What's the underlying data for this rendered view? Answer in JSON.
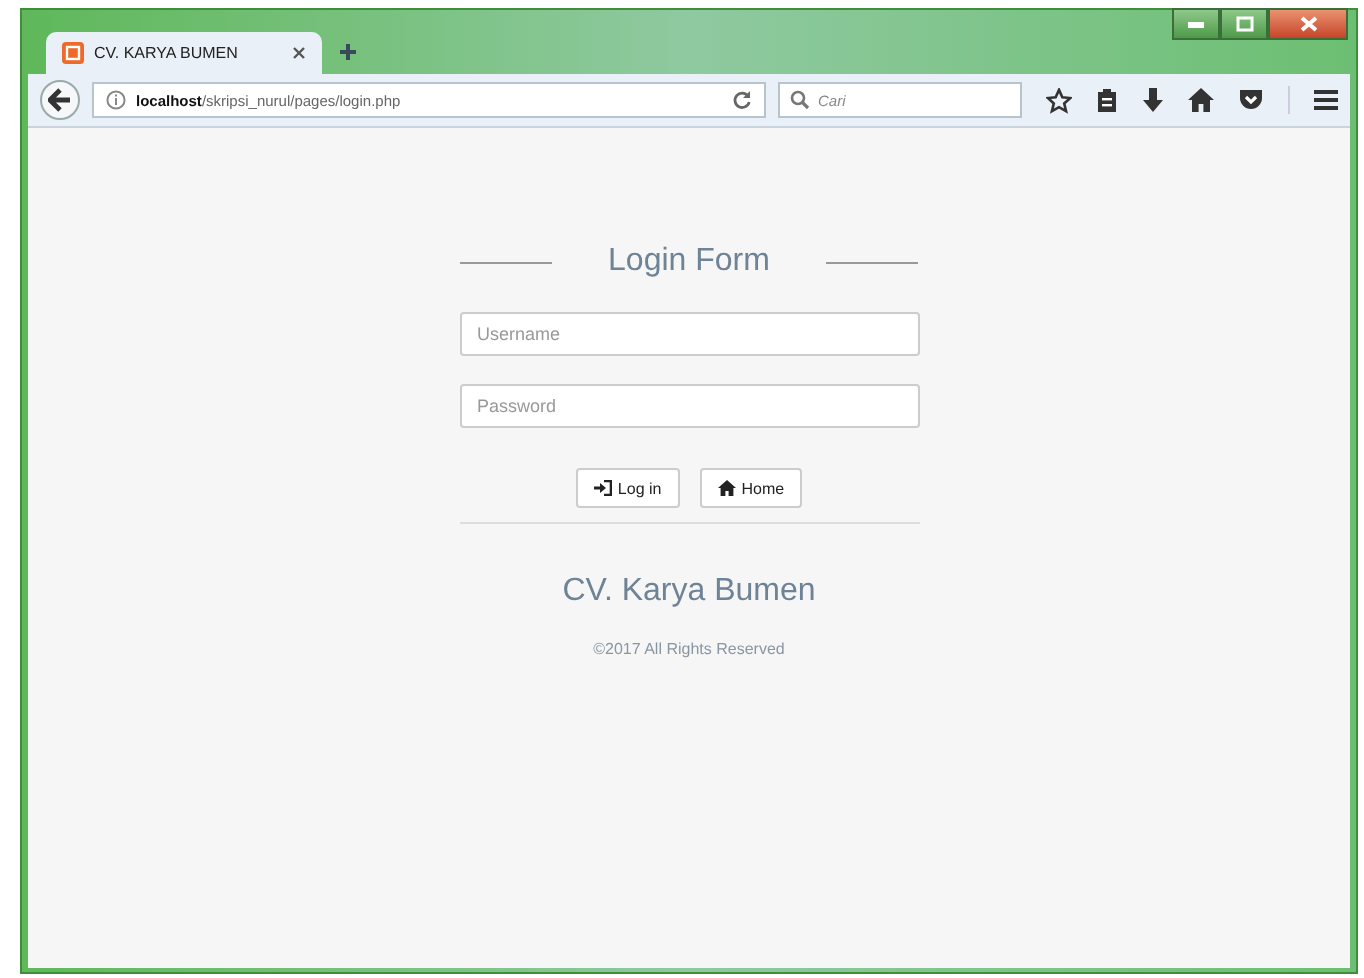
{
  "window": {
    "tabs": [
      {
        "title": "CV. KARYA BUMEN",
        "selected": true
      }
    ]
  },
  "address_bar": {
    "url": "**localhost**/skripsi_nurul/pages/login.php"
  },
  "search": {
    "placeholder": "Cari"
  },
  "login_form": {
    "title": "Login Form",
    "fields": [
      {
        "placeholder": "Username"
      },
      {
        "placeholder": "Password"
      }
    ],
    "buttons": [
      {
        "kind": "login",
        "label": "Log in"
      },
      {
        "kind": "home",
        "label": "Home"
      }
    ]
  },
  "footer": {
    "brand": "CV. Karya Bumen",
    "copyright": "©2017 All Rights Reserved"
  }
}
